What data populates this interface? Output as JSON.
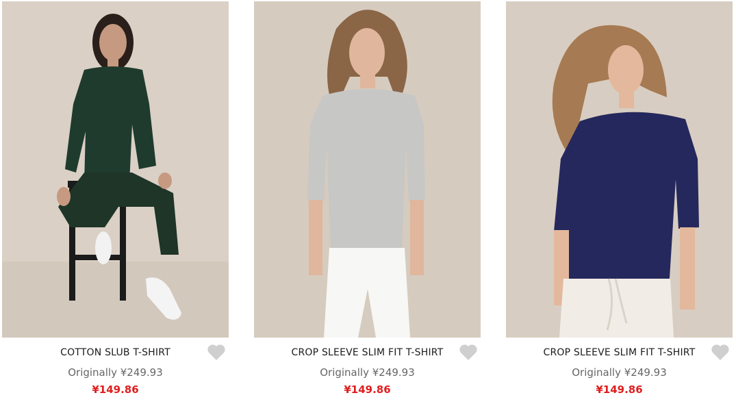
{
  "products": [
    {
      "name": "COTTON SLUB T-SHIRT",
      "original_price": "Originally ¥249.93",
      "sale_price": "¥149.86",
      "shirt_color": "#1f3b2e",
      "background_color": "#d9cfc4"
    },
    {
      "name": "CROP SLEEVE SLIM FIT T-SHIRT",
      "original_price": "Originally ¥249.93",
      "sale_price": "¥149.86",
      "shirt_color": "#c7c7c5",
      "background_color": "#d6cbbf"
    },
    {
      "name": "CROP SLEEVE SLIM FIT T-SHIRT",
      "original_price": "Originally ¥249.93",
      "sale_price": "¥149.86",
      "shirt_color": "#25285c",
      "background_color": "#d8cdc2"
    }
  ],
  "colors": {
    "sale_price": "#e01e1e",
    "original_price": "#666666",
    "heart_icon": "#cfcfcf"
  },
  "icons": {
    "wishlist": "heart-icon"
  }
}
